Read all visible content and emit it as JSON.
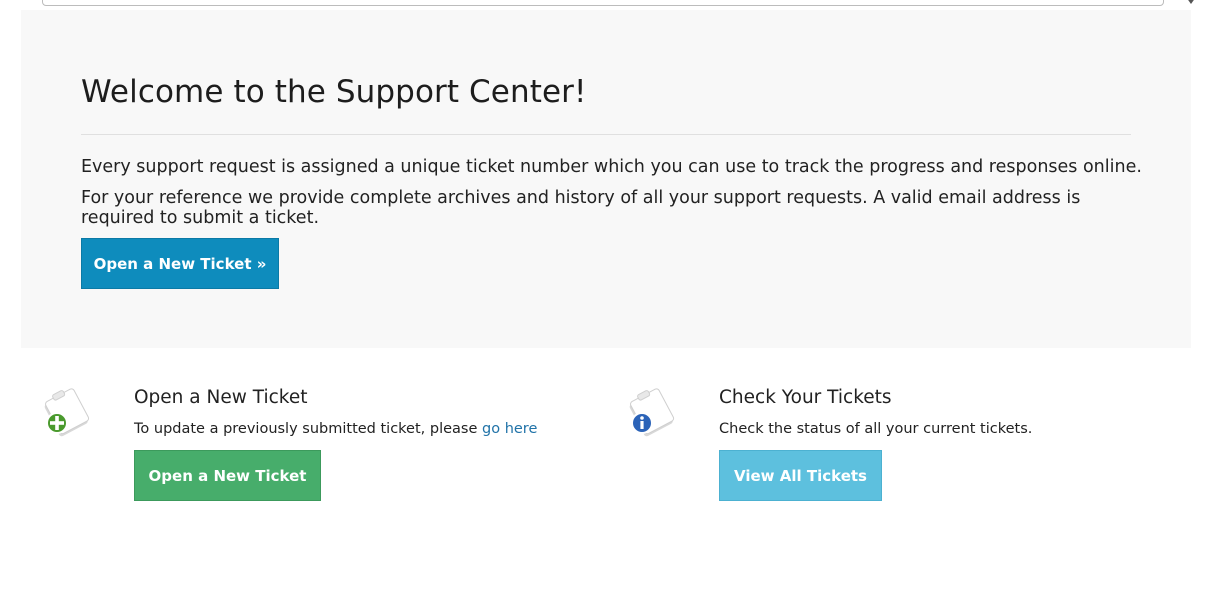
{
  "jumbotron": {
    "title": "Welcome to the Support Center!",
    "paragraph1": "Every support request is assigned a unique ticket number which you can use to track the progress and responses online.",
    "paragraph2": "For your reference we provide complete archives and history of all your support requests. A valid email address is required to submit a ticket.",
    "button_label": "Open a New Ticket »"
  },
  "features": {
    "open_ticket": {
      "icon": "new-ticket-icon",
      "title": "Open a New Ticket",
      "text": "To update a previously submitted ticket, please",
      "link_text": "go here",
      "button_label": "Open a New Ticket",
      "button_color": "#47ad6b"
    },
    "check_tickets": {
      "icon": "ticket-info-icon",
      "title": "Check Your Tickets",
      "text": "Check the status of all your current tickets.",
      "button_label": "View All Tickets",
      "button_color": "#5dc0de"
    }
  },
  "colors": {
    "primary": "#0e8cbd",
    "link": "#2173a8",
    "jumbotron_bg": "#f8f8f8"
  }
}
